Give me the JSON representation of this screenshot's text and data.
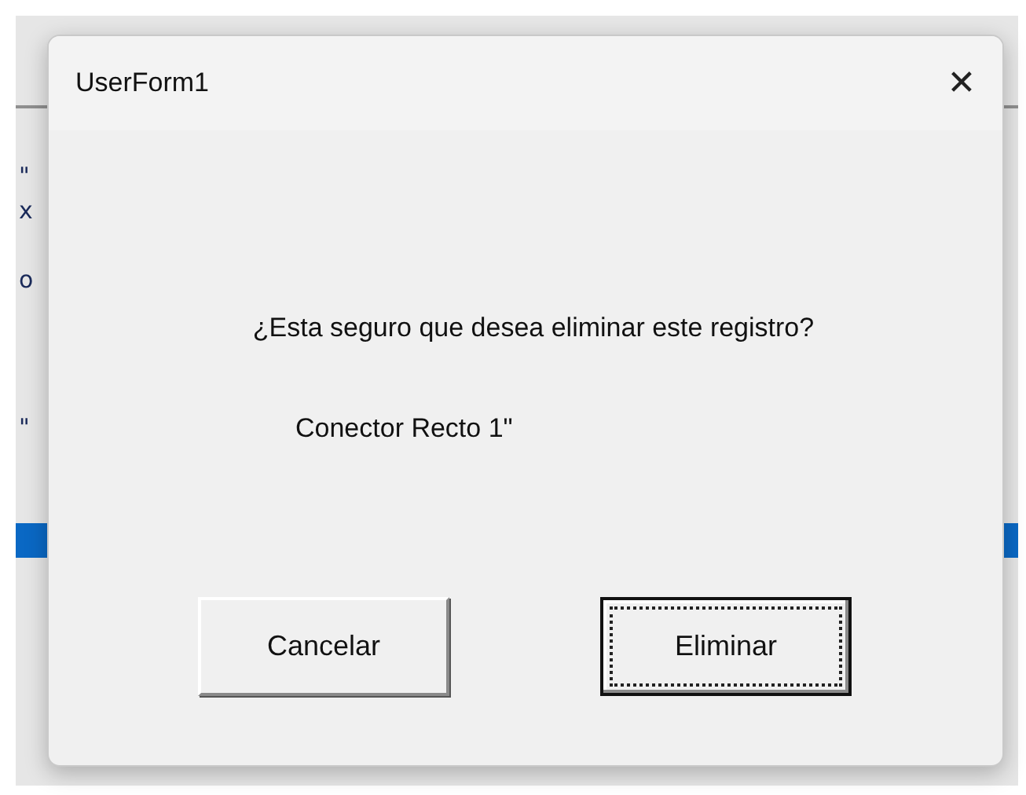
{
  "background": {
    "fragments": [
      "\"",
      "x",
      "o",
      "\""
    ]
  },
  "window": {
    "title": "UserForm1",
    "close": "✕"
  },
  "message": "¿Esta seguro que desea eliminar este registro?",
  "record": "Conector Recto 1\"",
  "buttons": [
    {
      "label": "Cancelar",
      "default": false
    },
    {
      "label": "Eliminar",
      "default": true
    }
  ]
}
